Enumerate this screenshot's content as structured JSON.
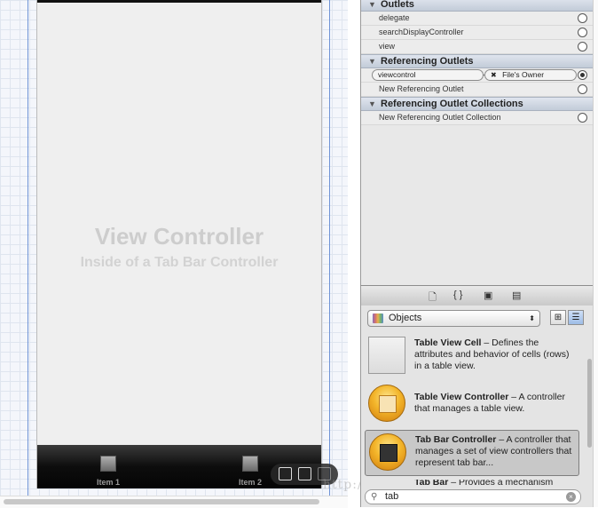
{
  "canvas": {
    "view_controller": {
      "title": "View Controller",
      "subtitle": "Inside of a Tab Bar Controller"
    },
    "tab_bar": {
      "items": [
        {
          "label": "Item 1"
        },
        {
          "label": "Item 2"
        }
      ]
    },
    "watermark": "http://blog.csdn.net/Enganolud"
  },
  "inspector": {
    "outlets": {
      "header": "Outlets",
      "rows": [
        {
          "label": "delegate"
        },
        {
          "label": "searchDisplayController"
        },
        {
          "label": "view"
        }
      ]
    },
    "referencing_outlets": {
      "header": "Referencing Outlets",
      "connection": {
        "outlet": "viewcontrol",
        "target": "File's Owner",
        "remove_glyph": "✖"
      },
      "new_label": "New Referencing Outlet"
    },
    "referencing_collections": {
      "header": "Referencing Outlet Collections",
      "new_label": "New Referencing Outlet Collection"
    }
  },
  "library": {
    "tabs": [
      {
        "icon": "file-template-icon",
        "glyph": "🗋"
      },
      {
        "icon": "code-snippet-icon",
        "glyph": "{ }"
      },
      {
        "icon": "object-cube-icon",
        "glyph": "▣"
      },
      {
        "icon": "media-icon",
        "glyph": "▤"
      }
    ],
    "filter_popup": {
      "label": "Objects",
      "arrow": "⬍"
    },
    "view_modes": [
      {
        "icon": "grid-view-icon",
        "glyph": "⊞"
      },
      {
        "icon": "list-view-icon",
        "glyph": "☰"
      }
    ],
    "items": [
      {
        "name": "Table View Cell",
        "desc": " – Defines the attributes and behavior of cells (rows) in a table view.",
        "icon": "table-view-cell-icon"
      },
      {
        "name": "Table View Controller",
        "desc": " – A controller that manages a table view.",
        "icon": "table-view-controller-icon"
      },
      {
        "name": "Tab Bar Controller",
        "desc": " – A controller that manages a set of view controllers that represent tab bar...",
        "icon": "tab-bar-controller-icon",
        "selected": true
      },
      {
        "name": "Tab Bar",
        "desc": " – Provides a mechanism",
        "icon": "tab-bar-icon"
      }
    ],
    "search": {
      "value": "tab",
      "icon": "search-icon",
      "clear": "×"
    }
  },
  "colors": {
    "guide_blue": "#6f93d6",
    "tab_orb": "#f3b52a",
    "selection": "#c8c8c8"
  }
}
